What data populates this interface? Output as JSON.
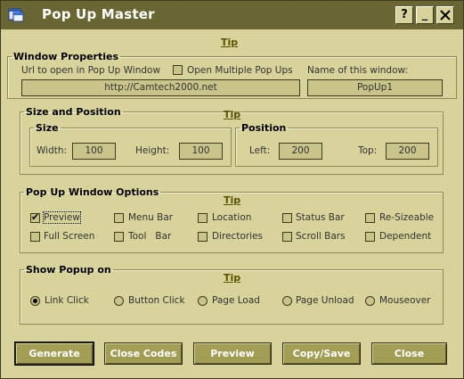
{
  "titlebar": {
    "title": "Pop Up Master",
    "help_label": "?",
    "minimize_label": "_"
  },
  "tips": {
    "main": "Tip",
    "size_position": "Tip",
    "options": "Tip",
    "show_popup": "Tip"
  },
  "window_properties": {
    "legend": "Window Properties",
    "url_label": "Url to open in Pop Up Window",
    "url_value": "http://Camtech2000.net",
    "multiple_label": "Open Multiple Pop Ups",
    "multiple_checked": false,
    "name_label": "Name of this window:",
    "name_value": "PopUp1"
  },
  "size_position": {
    "legend": "Size and Position",
    "size": {
      "legend": "Size",
      "width_label": "Width:",
      "width_value": "100",
      "height_label": "Height:",
      "height_value": "100"
    },
    "position": {
      "legend": "Position",
      "left_label": "Left:",
      "left_value": "200",
      "top_label": "Top:",
      "top_value": "200"
    }
  },
  "options": {
    "legend": "Pop Up Window Options",
    "items": [
      {
        "label": "Preview",
        "checked": true
      },
      {
        "label": "Menu Bar",
        "checked": false
      },
      {
        "label": "Location",
        "checked": false
      },
      {
        "label": "Status Bar",
        "checked": false
      },
      {
        "label": "Re-Sizeable",
        "checked": false
      },
      {
        "label": "Full Screen",
        "checked": false
      },
      {
        "label": "Tool   Bar",
        "checked": false
      },
      {
        "label": "Directories",
        "checked": false
      },
      {
        "label": "Scroll Bars",
        "checked": false
      },
      {
        "label": "Dependent",
        "checked": false
      }
    ]
  },
  "show_popup": {
    "legend": "Show Popup on",
    "selected": "Link Click",
    "items": [
      "Link Click",
      "Button Click",
      "Page Load",
      "Page Unload",
      "Mouseover"
    ]
  },
  "buttons": {
    "generate": "Generate",
    "close_codes": "Close Codes",
    "preview": "Preview",
    "copy_save": "Copy/Save",
    "close": "Close"
  }
}
